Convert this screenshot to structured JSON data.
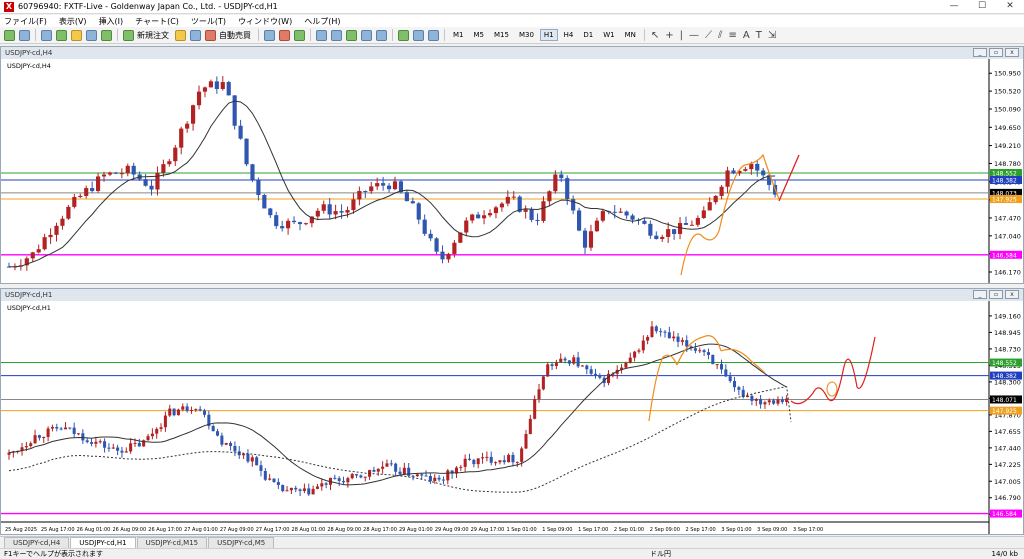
{
  "window": {
    "title": "60796940: FXTF-Live - Goldenway Japan Co., Ltd. - USDJPY-cd,H1",
    "minimize": "—",
    "maximize": "☐",
    "close": "✕"
  },
  "menu": [
    "ファイル(F)",
    "表示(V)",
    "挿入(I)",
    "チャート(C)",
    "ツール(T)",
    "ウィンドウ(W)",
    "ヘルプ(H)"
  ],
  "toolbar": {
    "new_order": "新規注文",
    "auto_trade": "自動売買",
    "timeframes": [
      "M1",
      "M5",
      "M15",
      "M30",
      "H1",
      "H4",
      "D1",
      "W1",
      "MN"
    ],
    "active_timeframe": "H1"
  },
  "chart_h4": {
    "window_title": "USDJPY-cd,H4",
    "symbol_label": "USDJPY-cd,H4",
    "price_ticks": [
      "150.950",
      "150.520",
      "150.090",
      "149.650",
      "149.210",
      "148.780",
      "148.340",
      "147.905",
      "147.470",
      "147.040",
      "146.610",
      "146.170"
    ],
    "level_labels": [
      {
        "price": "148.552",
        "color": "#2ca02c"
      },
      {
        "price": "148.382",
        "color": "#1f3fbf"
      },
      {
        "price": "148.073",
        "color": "#000000"
      },
      {
        "price": "147.925",
        "color": "#f0a020"
      },
      {
        "price": "146.584",
        "color": "#ff00ff"
      }
    ]
  },
  "chart_h1": {
    "window_title": "USDJPY-cd,H1",
    "symbol_label": "USDJPY-cd,H1",
    "price_ticks": [
      "149.160",
      "148.945",
      "148.730",
      "148.515",
      "148.300",
      "148.085",
      "147.870",
      "147.655",
      "147.440",
      "147.225",
      "147.005",
      "146.790",
      "146.575"
    ],
    "level_labels": [
      {
        "price": "148.552",
        "color": "#2ca02c"
      },
      {
        "price": "148.382",
        "color": "#1f3fbf"
      },
      {
        "price": "148.071",
        "color": "#000000"
      },
      {
        "price": "147.925",
        "color": "#f0a020"
      },
      {
        "price": "146.584",
        "color": "#ff00ff"
      }
    ],
    "time_ticks": [
      "25 Aug 2025",
      "25 Aug 17:00",
      "26 Aug 01:00",
      "26 Aug 09:00",
      "26 Aug 17:00",
      "27 Aug 01:00",
      "27 Aug 09:00",
      "27 Aug 17:00",
      "28 Aug 01:00",
      "28 Aug 09:00",
      "28 Aug 17:00",
      "29 Aug 01:00",
      "29 Aug 09:00",
      "29 Aug 17:00",
      "1 Sep 01:00",
      "1 Sep 09:00",
      "1 Sep 17:00",
      "2 Sep 01:00",
      "2 Sep 09:00",
      "2 Sep 17:00",
      "3 Sep 01:00",
      "3 Sep 09:00",
      "3 Sep 17:00"
    ]
  },
  "tabs": [
    "USDJPY-cd,H4",
    "USDJPY-cd,H1",
    "USDJPY-cd,M15",
    "USDJPY-cd,M5"
  ],
  "active_tab": "USDJPY-cd,H1",
  "status": {
    "help": "F1キーでヘルプが表示されます",
    "profile": "ドル円",
    "traffic": "14/0 kb"
  },
  "colors": {
    "bull": "#b22222",
    "bear": "#2f56b0",
    "ma": "#333333",
    "annotation_orange": "#f08c1a",
    "annotation_red": "#e0201f"
  }
}
